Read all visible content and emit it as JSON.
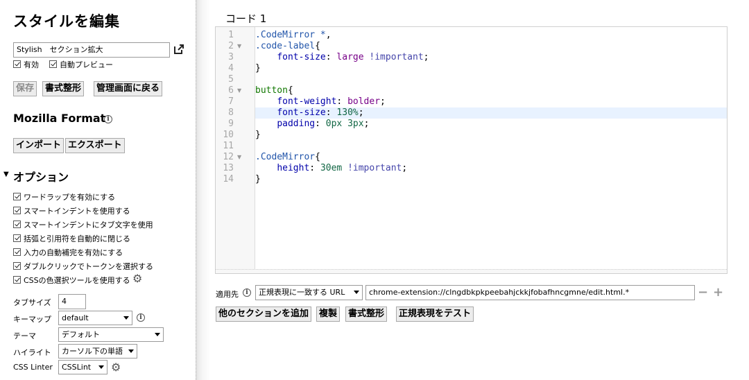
{
  "sidebar": {
    "title": "スタイルを編集",
    "style_name": "Stylish　セクション拡大",
    "enabled_label": "有効",
    "live_preview_label": "自動プレビュー",
    "buttons": {
      "save": "保存",
      "beautify": "書式整形",
      "back": "管理画面に戻る"
    },
    "mozilla_format": {
      "heading": "Mozilla Format",
      "import": "インポート",
      "export": "エクスポート"
    },
    "options": {
      "heading": "オプション",
      "checkboxes": [
        "ワードラップを有効にする",
        "スマートインデントを使用する",
        "スマートインデントにタブ文字を使用",
        "括弧と引用符を自動的に閉じる",
        "入力の自動補完を有効にする",
        "ダブルクリックでトークンを選択する",
        "CSSの色選択ツールを使用する"
      ],
      "tab_size": {
        "label": "タブサイズ",
        "value": "4"
      },
      "keymap": {
        "label": "キーマップ",
        "value": "default"
      },
      "theme": {
        "label": "テーマ",
        "value": "デフォルト"
      },
      "highlight": {
        "label": "ハイライト",
        "value": "カーソル下の単語"
      },
      "linter": {
        "label": "CSS Linter",
        "value": "CSSLint"
      }
    }
  },
  "main": {
    "section_title": "コード 1",
    "code_lines": [
      {
        "num": "1",
        "fold": "",
        "tokens": [
          [
            ".CodeMirror *",
            "c-sel"
          ],
          [
            ",",
            "c-pun"
          ]
        ]
      },
      {
        "num": "2",
        "fold": "▼",
        "tokens": [
          [
            ".code-label",
            "c-sel"
          ],
          [
            "{",
            "c-pun"
          ]
        ]
      },
      {
        "num": "3",
        "fold": "",
        "tokens": [
          [
            "    ",
            "c-pun"
          ],
          [
            "font-size",
            "c-prop"
          ],
          [
            ": ",
            "c-pun"
          ],
          [
            "large",
            "c-kw"
          ],
          [
            " ",
            "c-pun"
          ],
          [
            "!important",
            "c-imp"
          ],
          [
            ";",
            "c-pun"
          ]
        ]
      },
      {
        "num": "4",
        "fold": "",
        "tokens": [
          [
            "}",
            "c-pun"
          ]
        ]
      },
      {
        "num": "5",
        "fold": "",
        "tokens": []
      },
      {
        "num": "6",
        "fold": "▼",
        "tokens": [
          [
            "button",
            "c-tag"
          ],
          [
            "{",
            "c-pun"
          ]
        ]
      },
      {
        "num": "7",
        "fold": "",
        "tokens": [
          [
            "    ",
            "c-pun"
          ],
          [
            "font-weight",
            "c-prop"
          ],
          [
            ": ",
            "c-pun"
          ],
          [
            "bolder",
            "c-kw"
          ],
          [
            ";",
            "c-pun"
          ]
        ]
      },
      {
        "num": "8",
        "fold": "",
        "tokens": [
          [
            "    ",
            "c-pun"
          ],
          [
            "font-size",
            "c-prop"
          ],
          [
            ": ",
            "c-pun"
          ],
          [
            "130%",
            "c-num"
          ],
          [
            ";",
            "c-pun"
          ]
        ]
      },
      {
        "num": "9",
        "fold": "",
        "tokens": [
          [
            "    ",
            "c-pun"
          ],
          [
            "padding",
            "c-prop"
          ],
          [
            ": ",
            "c-pun"
          ],
          [
            "0px",
            "c-num"
          ],
          [
            " ",
            "c-pun"
          ],
          [
            "3px",
            "c-num"
          ],
          [
            ";",
            "c-pun"
          ]
        ]
      },
      {
        "num": "10",
        "fold": "",
        "tokens": [
          [
            "}",
            "c-pun"
          ]
        ]
      },
      {
        "num": "11",
        "fold": "",
        "tokens": []
      },
      {
        "num": "12",
        "fold": "▼",
        "tokens": [
          [
            ".CodeMirror",
            "c-sel"
          ],
          [
            "{",
            "c-pun"
          ]
        ]
      },
      {
        "num": "13",
        "fold": "",
        "tokens": [
          [
            "    ",
            "c-pun"
          ],
          [
            "height",
            "c-prop"
          ],
          [
            ": ",
            "c-pun"
          ],
          [
            "30em",
            "c-num"
          ],
          [
            " ",
            "c-pun"
          ],
          [
            "!important",
            "c-imp"
          ],
          [
            ";",
            "c-pun"
          ]
        ]
      },
      {
        "num": "14",
        "fold": "",
        "tokens": [
          [
            "}",
            "c-pun"
          ]
        ]
      }
    ],
    "active_line": 8,
    "applies_to": {
      "label": "適用先",
      "type_value": "正規表現に一致する URL",
      "pattern_value": "chrome-extension://clngdbkpkpeebahjckkjfobafhncgmne/edit.html.*"
    },
    "buttons": {
      "add_section": "他のセクションを追加",
      "clone": "複製",
      "beautify": "書式整形",
      "test_regexp": "正規表現をテスト"
    }
  }
}
